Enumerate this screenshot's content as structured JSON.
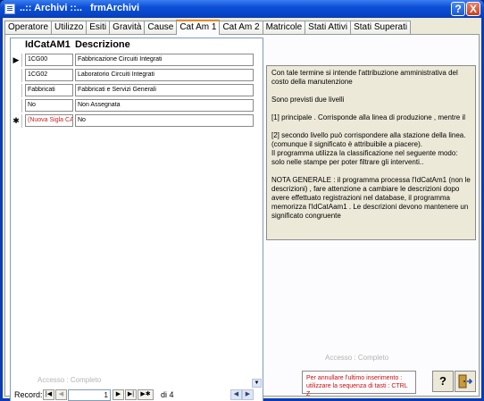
{
  "window": {
    "title": "..:: Archivi ::..   frmArchivi",
    "help_label": "?",
    "close_label": "X"
  },
  "tabs": [
    {
      "label": "Operatore"
    },
    {
      "label": "Utilizzo"
    },
    {
      "label": "Esiti"
    },
    {
      "label": "Gravità"
    },
    {
      "label": "Cause"
    },
    {
      "label": "Cat Am 1"
    },
    {
      "label": "Cat Am 2"
    },
    {
      "label": "Matricole"
    },
    {
      "label": "Stati Attivi"
    },
    {
      "label": "Stati Superati"
    }
  ],
  "grid": {
    "headers": {
      "col1": "IdCatAM1",
      "col2": "Descrizione"
    },
    "rows": [
      {
        "selector": "▶",
        "id": "1CG00",
        "descrizione": "Fabbricazione Circuiti Integrati"
      },
      {
        "selector": "",
        "id": "1CG02",
        "descrizione": "Laboratorio Circuiti Integrati"
      },
      {
        "selector": "",
        "id": "Fabbricati",
        "descrizione": "Fabbricati e Servizi Generali"
      },
      {
        "selector": "",
        "id": "No",
        "descrizione": "Non Assegnata"
      }
    ],
    "new_row": {
      "selector": "✱",
      "id": "(Nuova Sigla CAT)",
      "descrizione": "No"
    },
    "access": "Accesso : Completo"
  },
  "navigator": {
    "label": "Record:",
    "current": "1",
    "of_text": "di 4",
    "first": "|◀",
    "prev": "◀",
    "next": "▶",
    "last": "▶|",
    "new": "▶✱"
  },
  "info": {
    "p1": "Con tale termine si intende l'attribuzione amministrativa del costo della manutenzione",
    "p2": "Sono previsti due livelli",
    "p3": "[1] principale . Corrisponde alla linea di produzione , mentre il",
    "p4": "[2] secondo livello può corrispondere alla stazione della linea. (comunque il significato è attribuibile a piacere).",
    "p5": "Il programma utilizza la classificazione nel seguente modo: solo nelle stampe per poter filtrare gli interventi..",
    "p6": "NOTA GENERALE : il programma processa l'IdCatAm1 (non le descrizioni) ,  fare attenzione a cambiare le descrizioni dopo avere effettuato registrazioni nel database, il programma memorizza l'IdCatAam1 . Le descrizioni devono mantenere un significato congruente"
  },
  "form_access": "Accesso : Completo",
  "undo_hint": {
    "line1": "Per annullare l'ultimo inserimento :",
    "line2": "utilizzare la sequenza di tasti :    CTRL   Z"
  },
  "buttons": {
    "help_icon": "?",
    "exit_icon": "⇥"
  },
  "colors": {
    "title_bar": "#0c4fd6",
    "active_tab_accent": "#e68b2c",
    "new_row_text": "#cc2020",
    "hint_text": "#cc1010"
  }
}
